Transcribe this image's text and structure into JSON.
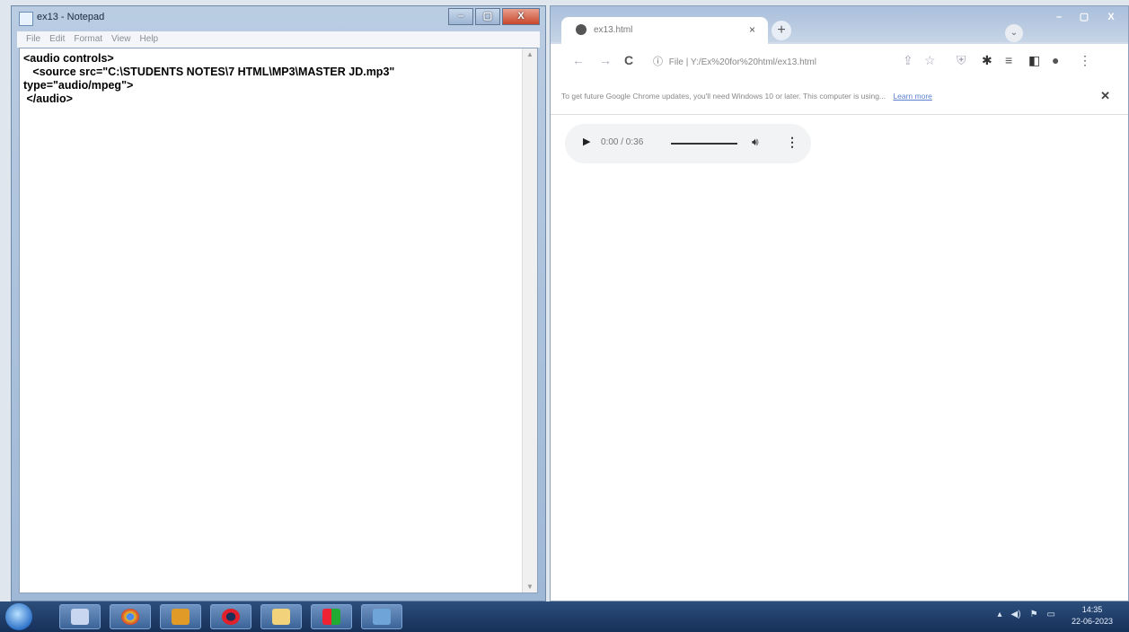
{
  "notepad": {
    "title": "ex13 - Notepad",
    "menu": [
      "File",
      "Edit",
      "Format",
      "View",
      "Help"
    ],
    "content": "<audio controls>\n   <source src=\"C:\\STUDENTS NOTES\\7 HTML\\MP3\\MASTER JD.mp3\"\ntype=\"audio/mpeg\">\n </audio>",
    "window_buttons": [
      "–",
      "▢",
      "X"
    ]
  },
  "chrome": {
    "tab_title": "ex13.html",
    "tab_close": "×",
    "new_tab": "+",
    "omnibox_scheme": "File",
    "omnibox_url": "Y:/Ex%20for%20html/ex13.html",
    "infobar_text": "To get future Google Chrome updates, you'll need Windows 10 or later. This computer is using...",
    "infobar_link": "Learn more",
    "infobar_close": "✕",
    "window_buttons": [
      "–",
      "▢",
      "X"
    ],
    "audio": {
      "time": "0:00 / 0:36",
      "volume_level": 1.0,
      "progress": 0.0
    }
  },
  "taskbar": {
    "apps": [
      "start",
      "paint",
      "chrome",
      "media",
      "opera",
      "explorer",
      "office",
      "documents"
    ],
    "clock_time": "14:35",
    "clock_date": "22-06-2023"
  },
  "colors": {
    "taskbar": "#1d3a66",
    "notepad_frame": "#b9cce2",
    "link": "#5b7fcf"
  }
}
